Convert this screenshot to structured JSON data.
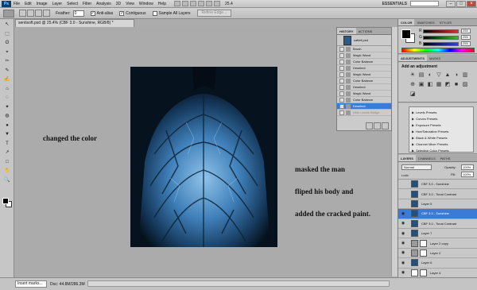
{
  "menubar": {
    "logo": "Ps",
    "items": [
      "File",
      "Edit",
      "Image",
      "Layer",
      "Select",
      "Filter",
      "Analysis",
      "3D",
      "View",
      "Window",
      "Help"
    ],
    "zoom": "25.4",
    "workspace": "ESSENTIALS",
    "window_buttons": [
      "–",
      "□",
      "×"
    ]
  },
  "options_bar": {
    "feather_label": "Feather:",
    "feather_value": "0",
    "antialias_label": "Anti-alias",
    "contiguous_label": "Contiguous",
    "sample_label": "Sample All Layers",
    "refine_label": "Refine Edge..."
  },
  "document": {
    "tab_title": "sentisoft.psd @ 25.4% (CBF 3.0 - Sunshine, RGB/8) *",
    "annotations": [
      "changed the color",
      "masked the man",
      "fliped his body and",
      "added the cracked paint."
    ]
  },
  "status": {
    "zoom": "Insert marks...",
    "doc_info": "Doc: 44.8M/286.3M"
  },
  "history": {
    "tabs": [
      "HISTORY",
      "ACTIONS"
    ],
    "snapshot": "cattell.psd",
    "items": [
      {
        "label": "Brush",
        "state": "normal"
      },
      {
        "label": "Magic Wand",
        "state": "normal"
      },
      {
        "label": "Color Balance",
        "state": "normal"
      },
      {
        "label": "Deselect",
        "state": "normal"
      },
      {
        "label": "Magic Wand",
        "state": "normal"
      },
      {
        "label": "Color Balance",
        "state": "normal"
      },
      {
        "label": "Deselect",
        "state": "normal"
      },
      {
        "label": "Magic Wand",
        "state": "normal"
      },
      {
        "label": "Color Balance",
        "state": "normal"
      },
      {
        "label": "Deselect",
        "state": "active"
      },
      {
        "label": "Hide Levels Bridge",
        "state": "dim"
      }
    ]
  },
  "color_panel": {
    "tabs": [
      "COLOR",
      "SWATCHES",
      "STYLES"
    ],
    "channels": [
      {
        "label": "R",
        "value": "255",
        "color": "#e03030"
      },
      {
        "label": "G",
        "value": "255",
        "color": "#30c030"
      },
      {
        "label": "B",
        "value": "255",
        "color": "#3040e0"
      }
    ]
  },
  "adjustments": {
    "tabs": [
      "ADJUSTMENTS",
      "MASKS"
    ],
    "title": "Add an adjustment",
    "icons": [
      "☀",
      "▤",
      "◐",
      "▽",
      "▲",
      "◑",
      "▥",
      "⊕",
      "▣",
      "◧",
      "▦",
      "◩",
      "■",
      "▨",
      "◪"
    ]
  },
  "presets": {
    "items": [
      "Levels Presets",
      "Curves Presets",
      "Exposure Presets",
      "Hue/Saturation Presets",
      "Black & White Presets",
      "Channel Mixer Presets",
      "Selective Color Presets"
    ]
  },
  "layers": {
    "tabs": [
      "LAYERS",
      "CHANNELS",
      "PATHS"
    ],
    "blend_mode": "Normal",
    "opacity_label": "Opacity:",
    "opacity": "100%",
    "fill_label": "Fill:",
    "fill": "100%",
    "lock_label": "Lock:",
    "items": [
      {
        "name": "CBF 3.0 - Sunshine",
        "thumb": "img",
        "mask": false,
        "visible": false,
        "selected": false
      },
      {
        "name": "CBF 3.0 - Tonal Contrast",
        "thumb": "img",
        "mask": false,
        "visible": false,
        "selected": false
      },
      {
        "name": "Layer 5",
        "thumb": "img",
        "mask": false,
        "visible": false,
        "selected": false
      },
      {
        "name": "CBF 3.0 - Sunshine",
        "thumb": "img",
        "mask": false,
        "visible": true,
        "selected": true
      },
      {
        "name": "CBF 3.0 - Tonal Contrast",
        "thumb": "img",
        "mask": false,
        "visible": true,
        "selected": false
      },
      {
        "name": "Layer 7",
        "thumb": "img",
        "mask": false,
        "visible": true,
        "selected": false
      },
      {
        "name": "Layer 2 copy",
        "thumb": "gray",
        "mask": true,
        "visible": true,
        "selected": false
      },
      {
        "name": "Layer 2",
        "thumb": "gray",
        "mask": true,
        "visible": true,
        "selected": false
      },
      {
        "name": "Layer 6",
        "thumb": "img",
        "mask": false,
        "visible": true,
        "selected": false
      },
      {
        "name": "Layer 4",
        "thumb": "white",
        "mask": true,
        "visible": true,
        "selected": false
      }
    ]
  },
  "tools": [
    "↖",
    "⬚",
    "ʘ",
    "⌖",
    "✂",
    "✎",
    "✍",
    "⌂",
    "◌",
    "✦",
    "◍",
    "●",
    "▼",
    "T",
    "↗",
    "□",
    "✋",
    "🔍"
  ]
}
